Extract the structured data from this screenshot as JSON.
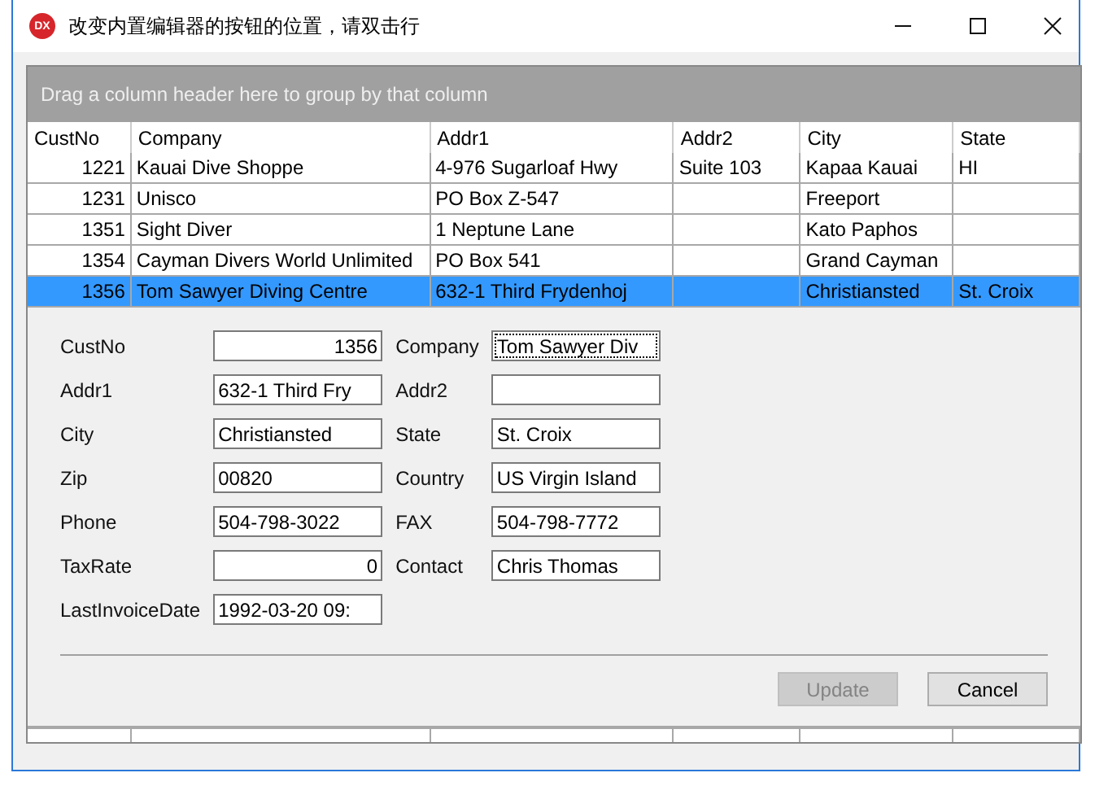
{
  "window": {
    "icon_text": "DX",
    "title": "改变内置编辑器的按钮的位置，请双击行"
  },
  "group_panel": {
    "hint": "Drag a column header here to group by that column"
  },
  "table": {
    "columns": [
      "CustNo",
      "Company",
      "Addr1",
      "Addr2",
      "City",
      "State"
    ],
    "rows": [
      {
        "selected": false,
        "cells": [
          "1221",
          "Kauai Dive Shoppe",
          "4-976 Sugarloaf Hwy",
          "Suite 103",
          "Kapaa Kauai",
          "HI"
        ]
      },
      {
        "selected": false,
        "cells": [
          "1231",
          "Unisco",
          "PO Box Z-547",
          null,
          "Freeport",
          null
        ]
      },
      {
        "selected": false,
        "cells": [
          "1351",
          "Sight Diver",
          "1 Neptune Lane",
          null,
          "Kato Paphos",
          null
        ]
      },
      {
        "selected": false,
        "cells": [
          "1354",
          "Cayman Divers World Unlimited",
          "PO Box 541",
          null,
          "Grand Cayman",
          null
        ]
      },
      {
        "selected": true,
        "cells": [
          "1356",
          "Tom Sawyer Diving Centre",
          "632-1 Third Frydenhoj",
          null,
          "Christiansted",
          "St. Croix"
        ]
      }
    ]
  },
  "edit_form": {
    "fields": [
      {
        "label": "CustNo",
        "value": "1356",
        "kind": "number",
        "focused": false
      },
      {
        "label": "Company",
        "value": "Tom Sawyer Div",
        "kind": "text",
        "focused": true
      },
      {
        "label": "Addr1",
        "value": "632-1 Third Fry",
        "kind": "text",
        "focused": false
      },
      {
        "label": "Addr2",
        "kind": "text",
        "focused": false
      },
      {
        "label": "City",
        "value": "Christiansted",
        "kind": "text",
        "focused": false
      },
      {
        "label": "State",
        "value": "St. Croix",
        "kind": "text",
        "focused": false
      },
      {
        "label": "Zip",
        "value": "00820",
        "kind": "text",
        "focused": false
      },
      {
        "label": "Country",
        "value": "US Virgin Island",
        "kind": "text",
        "focused": false
      },
      {
        "label": "Phone",
        "value": "504-798-3022",
        "kind": "text",
        "focused": false
      },
      {
        "label": "FAX",
        "value": "504-798-7772",
        "kind": "text",
        "focused": false
      },
      {
        "label": "TaxRate",
        "value": "0",
        "kind": "number",
        "focused": false
      },
      {
        "label": "Contact",
        "value": "Chris Thomas",
        "kind": "text",
        "focused": false
      },
      {
        "label": "LastInvoiceDate",
        "value": "1992-03-20 09:",
        "kind": "text",
        "focused": false
      }
    ],
    "buttons": [
      {
        "label": "Update",
        "disabled": true
      },
      {
        "label": "Cancel",
        "disabled": false
      }
    ]
  }
}
